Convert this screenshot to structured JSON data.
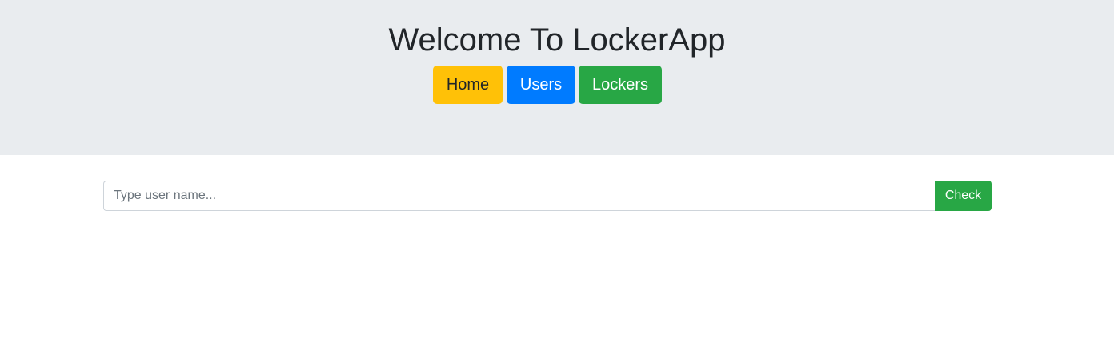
{
  "header": {
    "title": "Welcome To LockerApp"
  },
  "nav": {
    "home_label": "Home",
    "users_label": "Users",
    "lockers_label": "Lockers"
  },
  "search": {
    "placeholder": "Type user name...",
    "value": "",
    "button_label": "Check"
  },
  "colors": {
    "header_bg": "#e9ecef",
    "home": "#ffc107",
    "users": "#007bff",
    "lockers": "#28a745",
    "check": "#28a745"
  }
}
